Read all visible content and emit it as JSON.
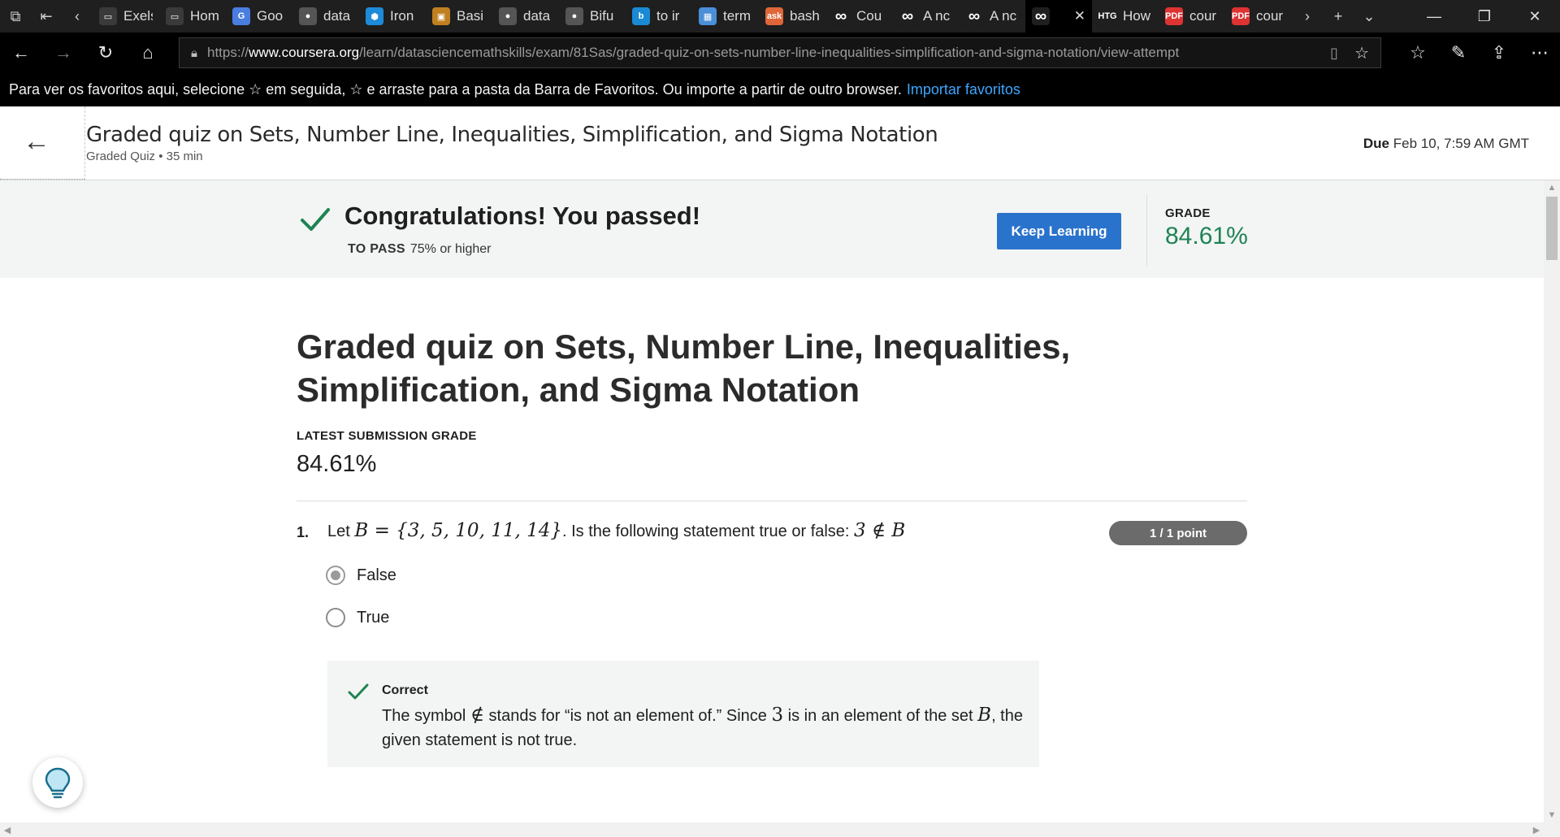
{
  "browser": {
    "tabs": [
      {
        "title": "Exels",
        "icon": "page-icon",
        "color": "#3a3a3a"
      },
      {
        "title": "Hom",
        "icon": "window-icon",
        "color": "#3a3a3a"
      },
      {
        "title": "Goo",
        "icon": "translate-icon",
        "color": "#4a7de0"
      },
      {
        "title": "data",
        "icon": "github-icon",
        "color": "#555555"
      },
      {
        "title": "Iron",
        "icon": "shield-icon",
        "color": "#1e8bd8"
      },
      {
        "title": "Basi",
        "icon": "portrait-icon",
        "color": "#c08020"
      },
      {
        "title": "data",
        "icon": "github-icon",
        "color": "#555555"
      },
      {
        "title": "Bifu",
        "icon": "github-icon",
        "color": "#555555"
      },
      {
        "title": "to ir",
        "icon": "bing-icon",
        "color": "#1a8ad4"
      },
      {
        "title": "term",
        "icon": "app-icon",
        "color": "#4a8fd8"
      },
      {
        "title": "bash",
        "icon": "ask-icon",
        "color": "#e0663a"
      },
      {
        "title": "Cou",
        "icon": "infinity-icon",
        "color": "#1f1f1f"
      },
      {
        "title": "A nc",
        "icon": "infinity-icon",
        "color": "#1f1f1f"
      },
      {
        "title": "A nc",
        "icon": "infinity-icon",
        "color": "#1f1f1f"
      },
      {
        "title": "",
        "icon": "infinity-icon",
        "color": "#1f1f1f",
        "active": true
      },
      {
        "title": "How",
        "icon": "htg-icon",
        "color": "#1f1f1f"
      },
      {
        "title": "cour",
        "icon": "pdf-icon",
        "color": "#d33"
      },
      {
        "title": "cour",
        "icon": "pdf-icon",
        "color": "#d33"
      }
    ],
    "url_prefix": "https://",
    "url_host": "www.coursera.org",
    "url_path": "/learn/datasciencemathskills/exam/81Sas/graded-quiz-on-sets-number-line-inequalities-simplification-and-sigma-notation/view-attempt",
    "favorites_bar_text": "Para ver os favoritos aqui, selecione ☆ em seguida, ☆ e arraste para a pasta da Barra de Favoritos. Ou importe a partir de outro browser.",
    "favorites_import_link": "Importar favoritos"
  },
  "header": {
    "title": "Graded quiz on Sets, Number Line, Inequalities, Simplification, and Sigma Notation",
    "subtitle": "Graded Quiz • 35 min",
    "due_label": "Due",
    "due_value": "Feb 10, 7:59 AM GMT"
  },
  "banner": {
    "message": "Congratulations! You passed!",
    "to_pass_label": "TO PASS",
    "to_pass_value": "75% or higher",
    "button_label": "Keep Learning",
    "grade_label": "GRADE",
    "grade_value": "84.61%",
    "grade_color": "#1f8354",
    "button_color": "#2a73cc"
  },
  "main": {
    "title": "Graded quiz on Sets, Number Line, Inequalities, Simplification, and Sigma Notation",
    "latest_label": "LATEST SUBMISSION GRADE",
    "latest_value": "84.61%",
    "question": {
      "number": "1.",
      "text_before": "Let ",
      "math_set": "B = {3, 5, 10, 11, 14}",
      "text_middle": ". Is the following statement true or false: ",
      "math_statement": "3 ∉ B",
      "points": "1 / 1 point",
      "options": [
        {
          "label": "False",
          "selected": true
        },
        {
          "label": "True",
          "selected": false
        }
      ],
      "feedback": {
        "title": "Correct",
        "text_1": "The symbol ",
        "symbol": "∉",
        "text_2": " stands for “is not an element of.” Since ",
        "math_3": "3",
        "text_3": " is in an element of the set ",
        "math_b": "B",
        "text_4": ", the given statement is not true."
      }
    }
  }
}
